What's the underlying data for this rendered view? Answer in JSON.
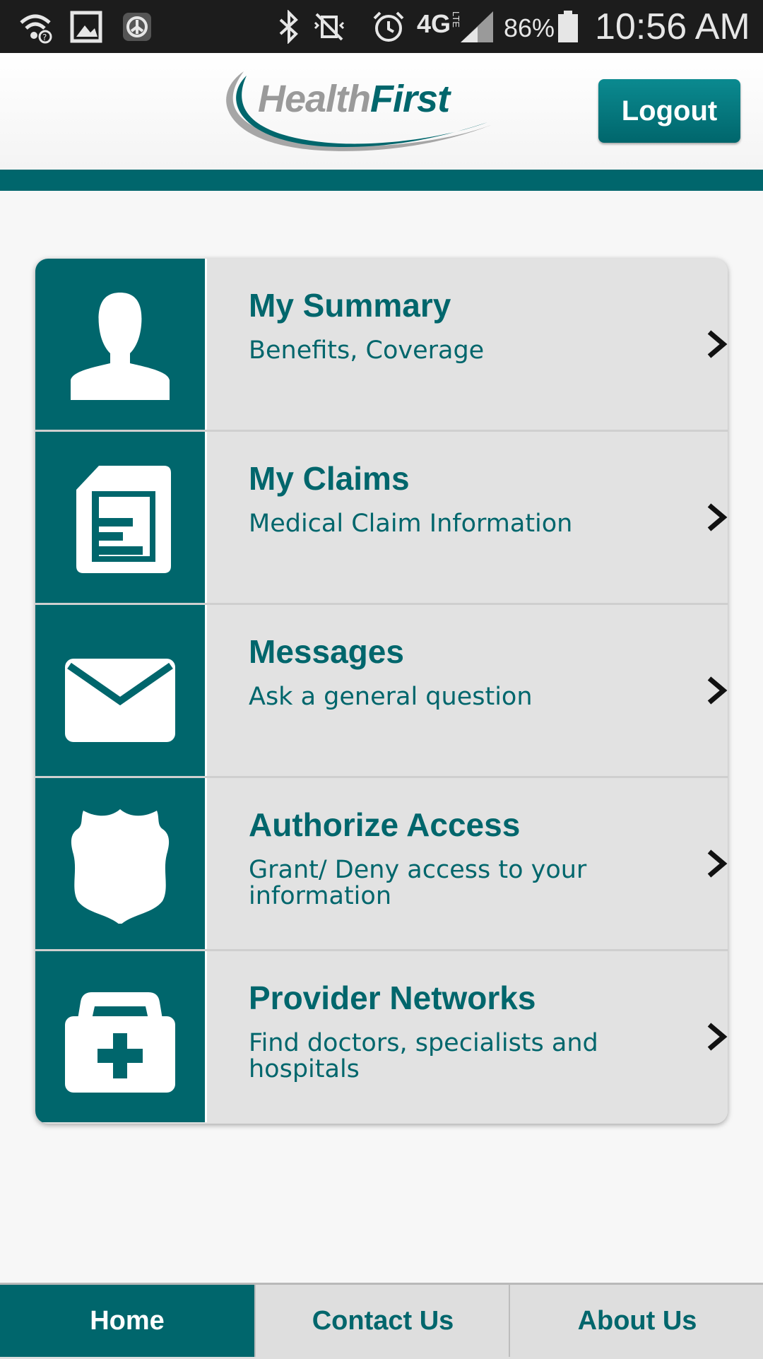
{
  "status_bar": {
    "battery": "86%",
    "time": "10:56 AM",
    "network": "4G",
    "network_sub": "LTE"
  },
  "header": {
    "logo_part1": "Health",
    "logo_part2": "First",
    "logout_label": "Logout"
  },
  "menu": {
    "items": [
      {
        "title": "My Summary",
        "subtitle": "Benefits, Coverage",
        "icon": "person-icon"
      },
      {
        "title": "My Claims",
        "subtitle": "Medical Claim Information",
        "icon": "document-icon"
      },
      {
        "title": "Messages",
        "subtitle": "Ask a general question",
        "icon": "envelope-icon"
      },
      {
        "title": "Authorize Access",
        "subtitle": "Grant/ Deny access to your information",
        "icon": "shield-icon"
      },
      {
        "title": "Provider Networks",
        "subtitle": "Find doctors, specialists and hospitals",
        "icon": "medical-kit-icon"
      }
    ]
  },
  "bottom_nav": {
    "tabs": [
      {
        "label": "Home",
        "active": true
      },
      {
        "label": "Contact Us",
        "active": false
      },
      {
        "label": "About Us",
        "active": false
      }
    ]
  },
  "colors": {
    "brand": "#00666c",
    "card_bg": "#e2e2e2",
    "status_bar_bg": "#1c1c1c"
  }
}
